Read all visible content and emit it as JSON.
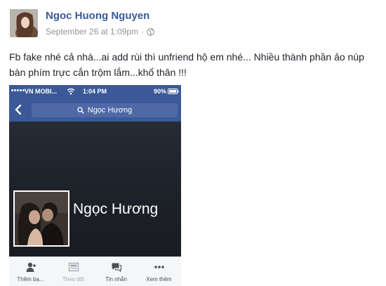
{
  "post": {
    "author": "Ngoc Huong Nguyen",
    "timestamp": "September 26 at 1:09pm",
    "separator": "·",
    "privacy_icon": "globe-icon",
    "text": "Fb fake nhé cả nhà...ai add rùi thì unfriend hộ em nhé... Nhiều thành phần ảo núp bàn phím trực cắn trộm lắm...khổ thân !!!"
  },
  "phone": {
    "status_bar": {
      "carrier": "VN MOBI...",
      "time": "1:04 PM",
      "battery": "90%"
    },
    "search_text": "Ngọc Hương",
    "profile_name": "Ngọc Hương",
    "actions": [
      {
        "label": "Thêm bạ...",
        "icon": "add-friend-icon"
      },
      {
        "label": "Theo dõi",
        "icon": "follow-icon"
      },
      {
        "label": "Tin nhắn",
        "icon": "message-icon"
      },
      {
        "label": "Xem thêm",
        "icon": "more-icon"
      }
    ]
  },
  "colors": {
    "brand_blue": "#3b5998",
    "meta_gray": "#90949c",
    "text": "#1d2129"
  }
}
